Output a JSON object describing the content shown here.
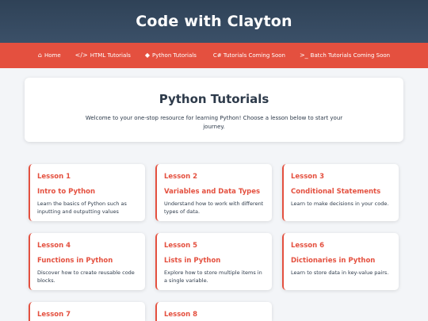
{
  "header": {
    "title": "Code with Clayton"
  },
  "nav": {
    "items": [
      {
        "icon": "home-icon",
        "glyph": "⌂",
        "label": "Home"
      },
      {
        "icon": "code-icon",
        "glyph": "</>",
        "label": "HTML Tutorials"
      },
      {
        "icon": "python-icon",
        "glyph": "◆",
        "label": "Python Tutorials"
      },
      {
        "icon": "csharp-icon",
        "glyph": "",
        "label": "C# Tutorials Coming Soon"
      },
      {
        "icon": "terminal-icon",
        "glyph": ">_",
        "label": "Batch Tutorials Coming Soon"
      }
    ]
  },
  "intro": {
    "title": "Python Tutorials",
    "text": "Welcome to your one-stop resource for learning Python! Choose a lesson below to start your journey."
  },
  "lessons": [
    {
      "number": "Lesson 1",
      "title": "Intro to Python",
      "desc": "Learn the basics of Python such as inputting and outputting values"
    },
    {
      "number": "Lesson 2",
      "title": "Variables and Data Types",
      "desc": "Understand how to work with different types of data."
    },
    {
      "number": "Lesson 3",
      "title": "Conditional Statements",
      "desc": "Learn to make decisions in your code."
    },
    {
      "number": "Lesson 4",
      "title": "Functions in Python",
      "desc": "Discover how to create reusable code blocks."
    },
    {
      "number": "Lesson 5",
      "title": "Lists in Python",
      "desc": "Explore how to store multiple items in a single variable."
    },
    {
      "number": "Lesson 6",
      "title": "Dictionaries in Python",
      "desc": "Learn to store data in key-value pairs."
    },
    {
      "number": "Lesson 7",
      "title": "",
      "desc": ""
    },
    {
      "number": "Lesson 8",
      "title": "",
      "desc": ""
    }
  ],
  "colors": {
    "accent": "#e4503f",
    "header": "#33475c",
    "background": "#f3f5f8"
  }
}
